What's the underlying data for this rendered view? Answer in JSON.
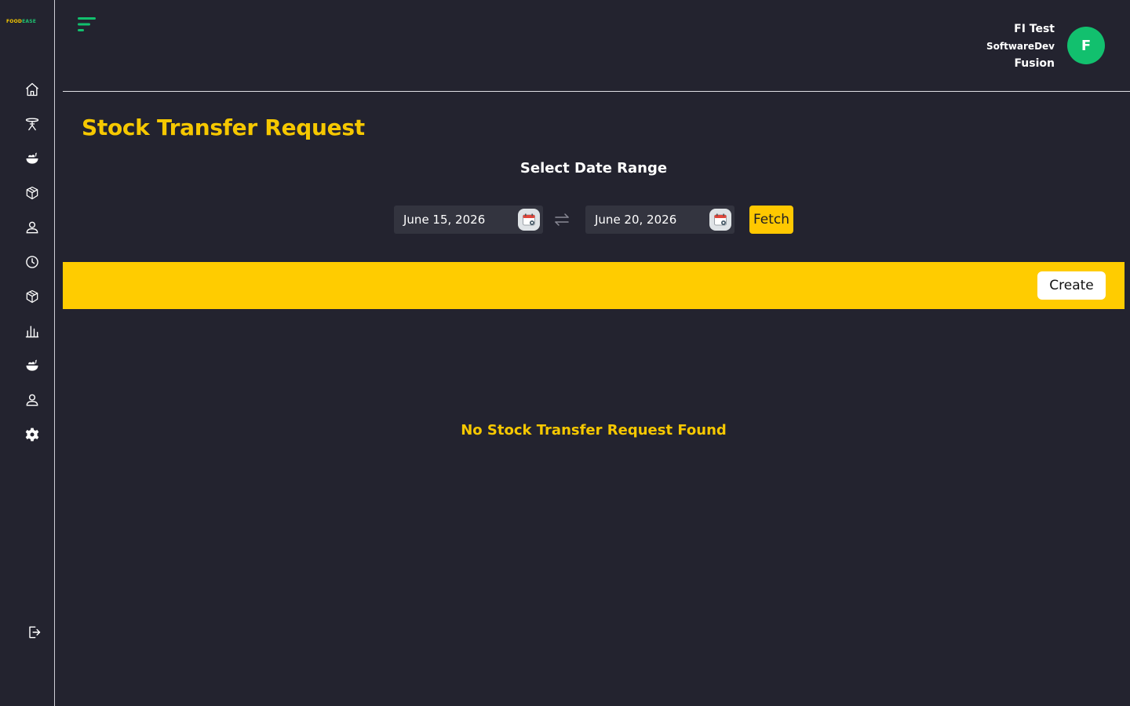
{
  "brand": {
    "logo_part1": "FOOD",
    "logo_part2": "EASE"
  },
  "colors": {
    "accent": "#ffcc00",
    "title": "#f6c800",
    "avatar": "#12c06e",
    "background": "#23232f"
  },
  "sidebar": {
    "items": [
      {
        "icon": "home-icon"
      },
      {
        "icon": "table-icon"
      },
      {
        "icon": "food-bowl-icon"
      },
      {
        "icon": "package-icon"
      },
      {
        "icon": "user-icon"
      },
      {
        "icon": "clock-icon"
      },
      {
        "icon": "package-icon"
      },
      {
        "icon": "bar-chart-icon"
      },
      {
        "icon": "food-bowl-icon"
      },
      {
        "icon": "user-icon"
      },
      {
        "icon": "gear-icon"
      }
    ],
    "logout_icon": "logout-icon"
  },
  "header": {
    "user_name": "FI Test",
    "user_role": "SoftwareDev",
    "user_company": "Fusion",
    "avatar_initial": "F"
  },
  "main": {
    "title": "Stock Transfer Request",
    "date_range_title": "Select Date Range",
    "start_date": "June 15, 2026",
    "end_date": "June 20, 2026",
    "fetch_label": "Fetch",
    "create_label": "Create",
    "empty_message": "No Stock Transfer Request Found"
  }
}
